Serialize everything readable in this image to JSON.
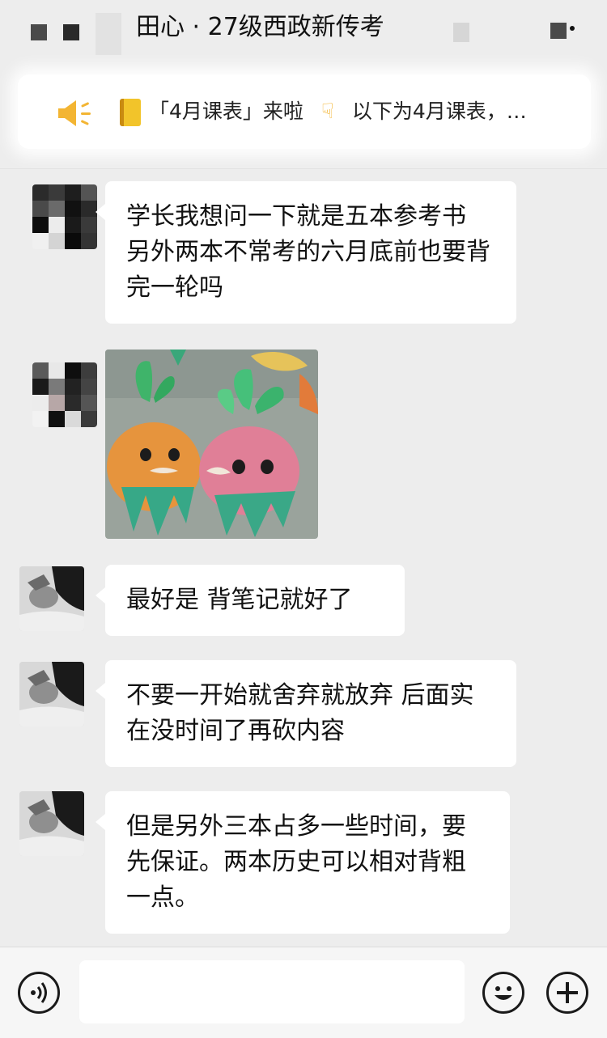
{
  "header": {
    "title": "田心 · 27级西政新传考"
  },
  "pinned": {
    "icons": [
      "speaker-icon",
      "notebook-icon",
      "pointing-down-hand-icon"
    ],
    "text_part1": "「4月课表」来啦",
    "text_part2": "以下为4月课表，…"
  },
  "messages": [
    {
      "sender": "member",
      "type": "text",
      "text": "学长我想问一下就是五本参考书 另外两本不常考的六月底前也要背完一轮吗"
    },
    {
      "sender": "member",
      "type": "sticker",
      "description_icon": "radish-sticker"
    },
    {
      "sender": "senior",
      "type": "text",
      "text": "最好是 背笔记就好了"
    },
    {
      "sender": "senior",
      "type": "text",
      "text": "不要一开始就舍弃就放弃 后面实在没时间了再砍内容"
    },
    {
      "sender": "senior",
      "type": "text",
      "text": "但是另外三本占多一些时间，要先保证。两本历史可以相对背粗一点。"
    }
  ],
  "input_bar": {
    "icons": [
      "voice-icon",
      "emoji-icon",
      "plus-icon"
    ],
    "value": ""
  },
  "colors": {
    "background": "#ededed",
    "bubble": "#ffffff",
    "accent_yellow": "#f3b533"
  }
}
